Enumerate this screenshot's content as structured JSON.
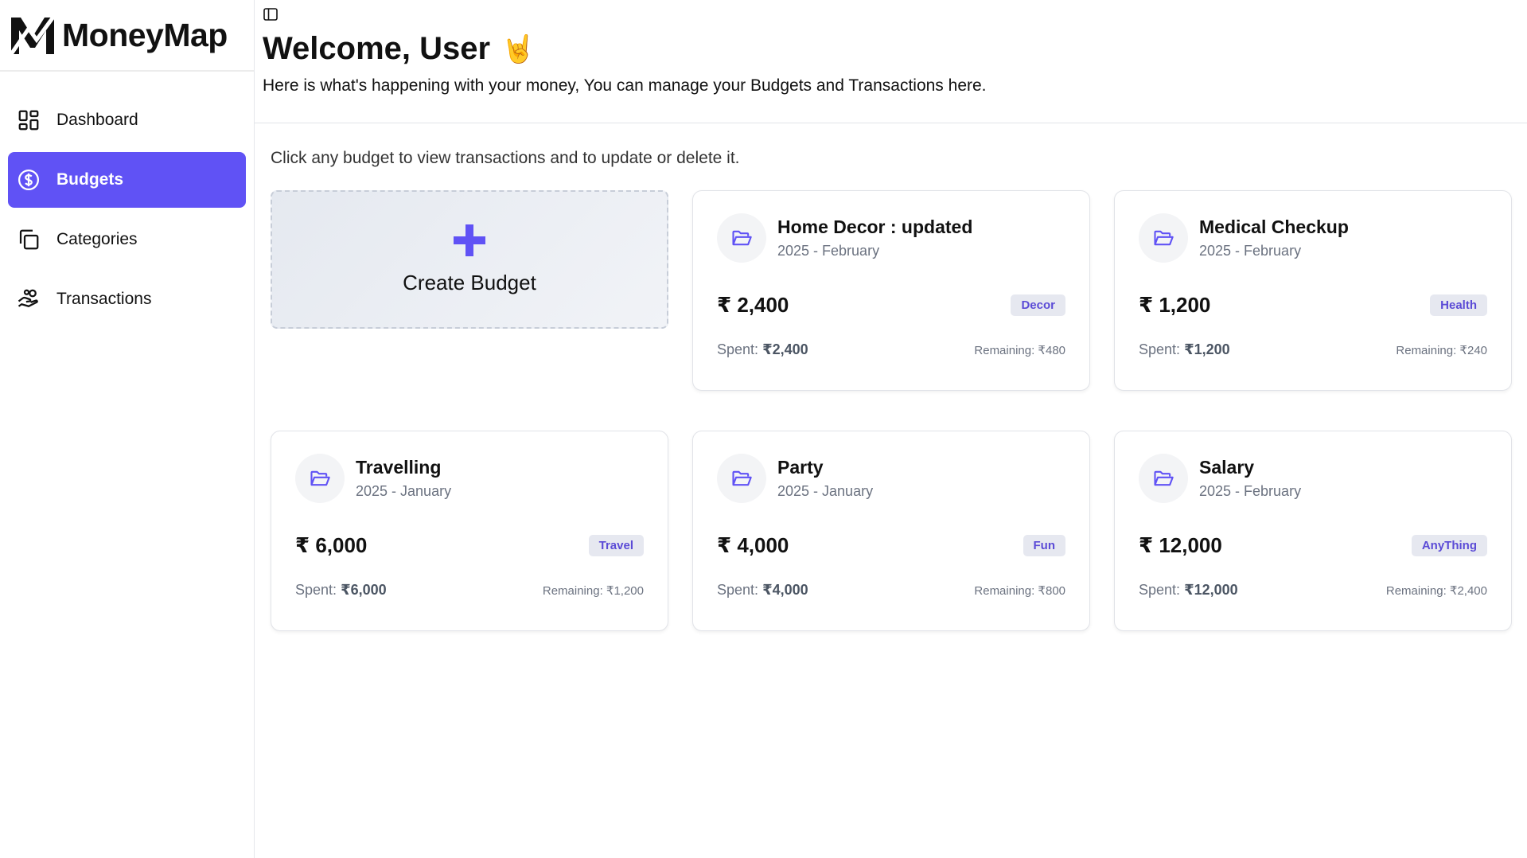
{
  "app": {
    "name": "MoneyMap",
    "accent": "#6052f5"
  },
  "sidebar": {
    "items": [
      {
        "label": "Dashboard",
        "icon": "dashboard-icon",
        "active": false
      },
      {
        "label": "Budgets",
        "icon": "dollar-circle-icon",
        "active": true
      },
      {
        "label": "Categories",
        "icon": "copy-icon",
        "active": false
      },
      {
        "label": "Transactions",
        "icon": "hand-coins-icon",
        "active": false
      }
    ]
  },
  "header": {
    "welcome": "Welcome, User",
    "emoji": "🤘",
    "subtitle": "Here is what's happening with your money, You can manage your Budgets and Transactions here."
  },
  "main": {
    "hint": "Click any budget to view transactions and to update or delete it.",
    "create_label": "Create Budget",
    "budgets": [
      {
        "title": "Home Decor : updated",
        "date": "2025 - February",
        "amount": "₹ 2,400",
        "category": "Decor",
        "spent_label": "Spent:",
        "spent": "₹2,400",
        "remaining": "Remaining: ₹480"
      },
      {
        "title": "Medical Checkup",
        "date": "2025 - February",
        "amount": "₹ 1,200",
        "category": "Health",
        "spent_label": "Spent:",
        "spent": "₹1,200",
        "remaining": "Remaining: ₹240"
      },
      {
        "title": "Travelling",
        "date": "2025 - January",
        "amount": "₹ 6,000",
        "category": "Travel",
        "spent_label": "Spent:",
        "spent": "₹6,000",
        "remaining": "Remaining: ₹1,200"
      },
      {
        "title": "Party",
        "date": "2025 - January",
        "amount": "₹ 4,000",
        "category": "Fun",
        "spent_label": "Spent:",
        "spent": "₹4,000",
        "remaining": "Remaining: ₹800"
      },
      {
        "title": "Salary",
        "date": "2025 - February",
        "amount": "₹ 12,000",
        "category": "AnyThing",
        "spent_label": "Spent:",
        "spent": "₹12,000",
        "remaining": "Remaining: ₹2,400"
      }
    ]
  }
}
